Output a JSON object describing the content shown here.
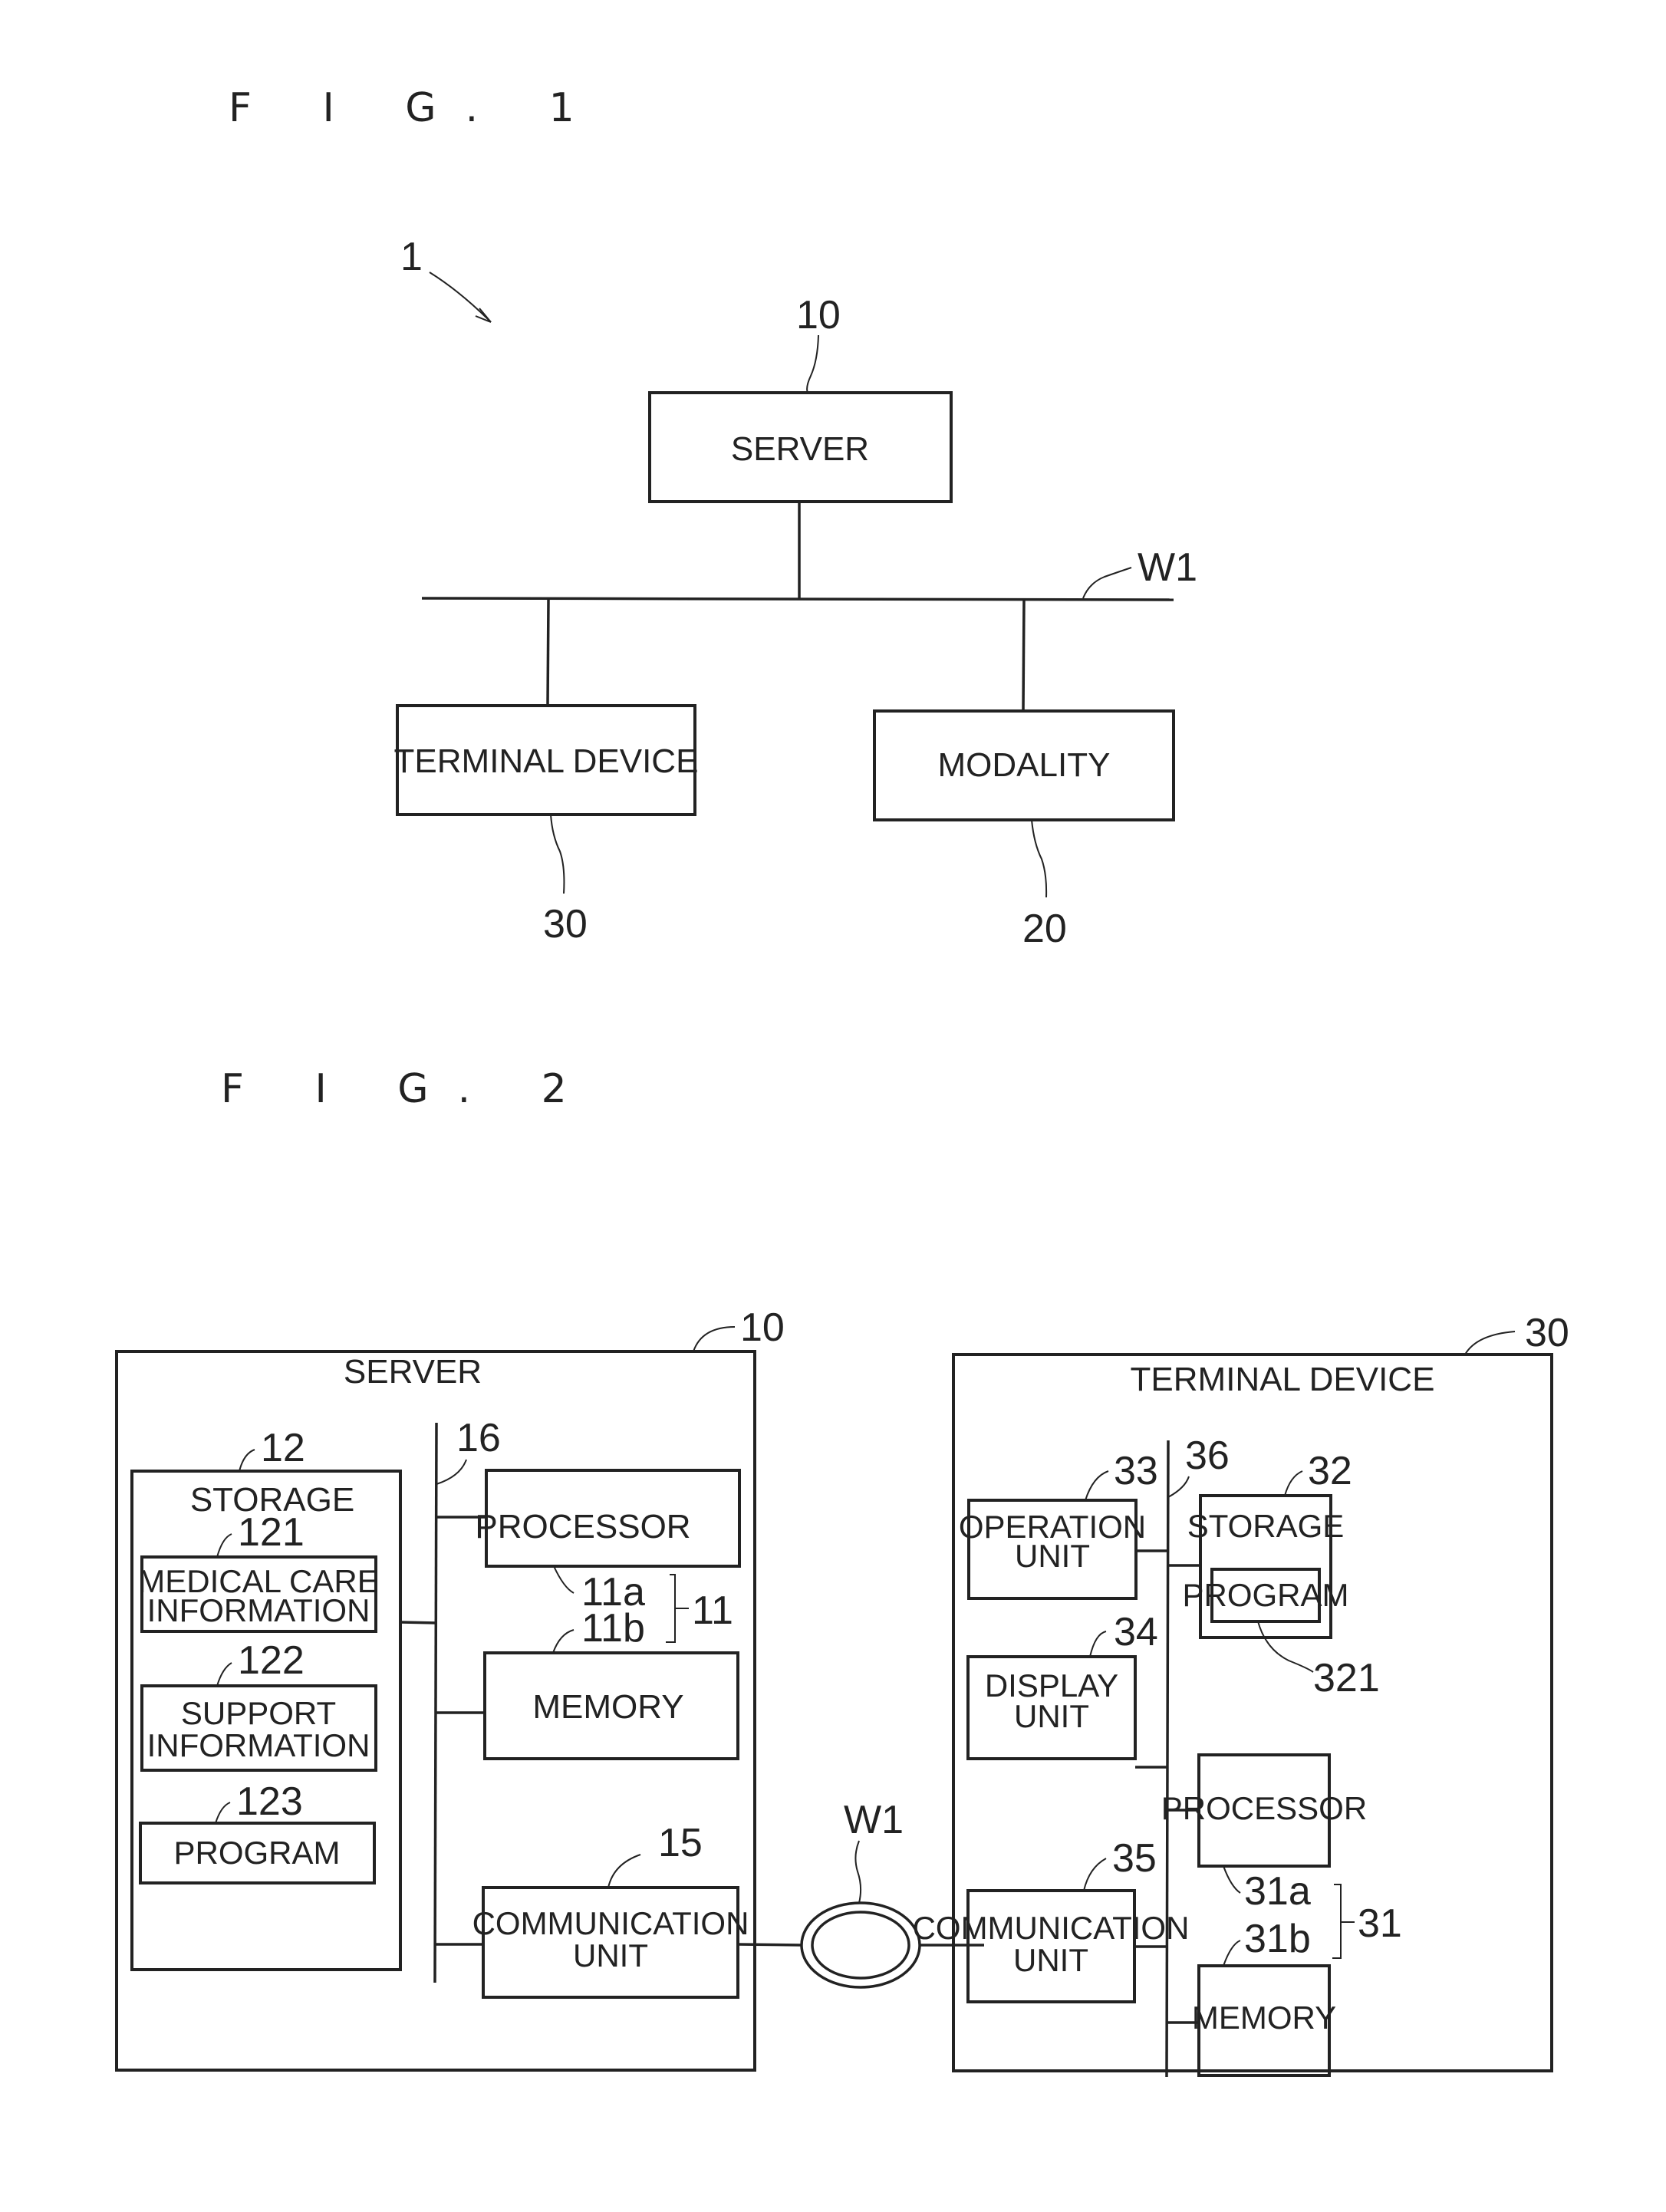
{
  "fig1": {
    "title": "F I G. 1",
    "system_ref": "1",
    "server": {
      "label": "SERVER",
      "ref": "10"
    },
    "network_ref": "W1",
    "terminal": {
      "label": "TERMINAL DEVICE",
      "ref": "30"
    },
    "modality": {
      "label": "MODALITY",
      "ref": "20"
    }
  },
  "fig2": {
    "title": "F I G. 2",
    "network_ref": "W1",
    "server": {
      "label": "SERVER",
      "ref": "10",
      "bus_ref": "16",
      "storage": {
        "label": "STORAGE",
        "ref": "12",
        "items": [
          {
            "line1": "MEDICAL CARE",
            "line2": "INFORMATION",
            "ref": "121"
          },
          {
            "line1": "SUPPORT",
            "line2": "INFORMATION",
            "ref": "122"
          },
          {
            "line1": "PROGRAM",
            "line2": "",
            "ref": "123"
          }
        ]
      },
      "processor": {
        "label": "PROCESSOR",
        "ref": "11a"
      },
      "memory": {
        "label": "MEMORY",
        "ref": "11b"
      },
      "controller_ref": "11",
      "comm": {
        "line1": "COMMUNICATION",
        "line2": "UNIT",
        "ref": "15"
      }
    },
    "terminal": {
      "label": "TERMINAL DEVICE",
      "ref": "30",
      "bus_ref": "36",
      "operation": {
        "line1": "OPERATION",
        "line2": "UNIT",
        "ref": "33"
      },
      "display": {
        "line1": "DISPLAY",
        "line2": "UNIT",
        "ref": "34"
      },
      "comm": {
        "line1": "COMMUNICATION",
        "line2": "UNIT",
        "ref": "35"
      },
      "storage": {
        "label": "STORAGE",
        "ref": "32",
        "program": {
          "label": "PROGRAM",
          "ref": "321"
        }
      },
      "processor": {
        "label": "PROCESSOR",
        "ref": "31a"
      },
      "memory": {
        "label": "MEMORY",
        "ref": "31b"
      },
      "controller_ref": "31"
    }
  }
}
